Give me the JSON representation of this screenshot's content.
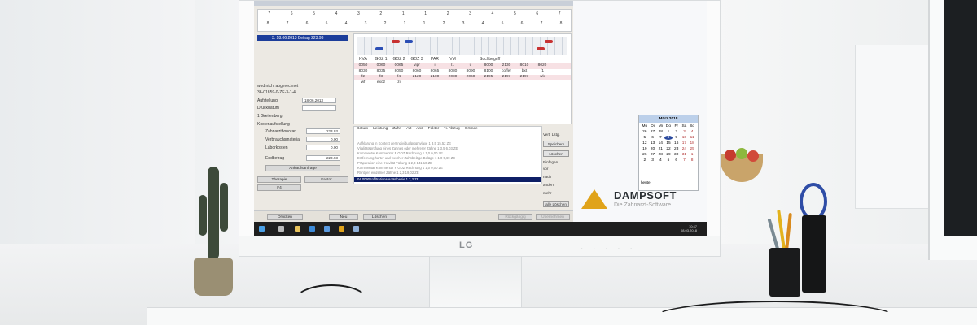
{
  "app": {
    "tooth_header": {
      "row_top": [
        "7",
        "6",
        "5",
        "4",
        "3",
        "2",
        "1",
        "1",
        "2",
        "3",
        "4",
        "5",
        "6",
        "7"
      ],
      "row_bottom": [
        "8",
        "7",
        "6",
        "5",
        "4",
        "3",
        "2",
        "1",
        "1",
        "2",
        "3",
        "4",
        "5",
        "6",
        "7",
        "8"
      ]
    },
    "left_panel": {
      "selected_item": "3. 18.06.2013 Betrag 223.93",
      "checkbox_label": "wird nicht abgerechnet",
      "reference_code": "36-01859-0-ZE-3-1-4",
      "aufstellung_label": "Aufstellung",
      "aufstellung_value": "18.06.2013",
      "druckdatum_label": "Druckdatum",
      "location": "1 Greifenberg",
      "kostenaufstellung_label": "Kostenaufstellung",
      "zahnarzthonorar_label": "Zahnarzthonorar",
      "zahnarzthonorar_value": "223.93",
      "verbrauchsmaterial_label": "Verbrauchsmaterial",
      "verbrauchsmaterial_value": "0.00",
      "laborkosten_label": "Laborkosten",
      "laborkosten_value": "0.00",
      "endbetrag_label": "Endbetrag",
      "endbetrag_value": "223.93",
      "ankaufsanfrage_button": "Ankaufsanfrage",
      "therapie_button": "Therapie",
      "faktor_button": "Faktor",
      "f4_button": "F4"
    },
    "codes_table": {
      "headers": [
        "KVA",
        "GOZ 1",
        "GOZ 2",
        "GOZ 3",
        "PAR",
        "VM",
        "",
        "Suchbegriff",
        "",
        "",
        ""
      ],
      "rows": [
        [
          "0050",
          "0060",
          "0065",
          "vipr",
          "i",
          "l1",
          "u",
          "8000",
          "2130",
          "8010",
          "8020"
        ],
        [
          "8030",
          "8035",
          "8050",
          "8060",
          "8065",
          "8080",
          "8090",
          "8100",
          "coffer",
          "bxt",
          "f1"
        ],
        [
          "f2",
          "f3",
          "f4",
          "2120",
          "2100",
          "2080",
          "2060",
          "2195",
          "2197",
          "2197",
          "wk"
        ],
        [
          "wf",
          "exc2",
          "zi",
          "",
          "",
          "",
          "",
          "",
          "",
          "",
          ""
        ]
      ]
    },
    "lower_table": {
      "headers": [
        "Datum",
        "Leistung",
        "Zahn",
        "Art",
        "Anz",
        "Faktor",
        "%-Abzug",
        "Gründe"
      ],
      "art_value": "ZE",
      "faktor_value": "2,3000",
      "abzug_value": "0",
      "rows": [
        "Aufklärung in Kontext der Individualprophylaxe 1 3,5 15,52 ZE",
        "Vitalitätsprüfung eines Zahnes oder mehrerer Zähne 1 3,5 6,03 ZE",
        "Kommentar Kommentar F GOZ Rechnung 1 1,0 0,00 ZE",
        "Entfernung harter und weicher Zahnbeläge Beläge 1 1,0 5,69 ZE",
        "Präparation einer Kavität Füllung 1 2,3 141,10 ZE",
        "Kommentar Kommentar F GOZ Rechnung 1 1,0 0,00 ZE",
        "Röntgen einzelner Zähne 1 2,3 19,02 ZE"
      ],
      "selected_row": "04 0090 Infiltrations/Anästhesie 1 2,3 ZE"
    },
    "right_controls": {
      "vert_label": "Vert. Lstg.",
      "speichern_button": "Speichern",
      "loeschen_button": "Löschen",
      "einfuegen_label": "Einfügen",
      "option_vor": "vor",
      "option_nach": "nach",
      "option_aendern": "ändern",
      "option_mehr": "mehr",
      "alle_loeschen_button": "alle Löschen"
    },
    "bottom_bar": {
      "drucken_button": "Drucken",
      "neu_button": "Neu",
      "loeschen_button": "Löschen",
      "rueckgaengig_button": "Rückgängig",
      "uebernehmen_button": "Übernehmen"
    }
  },
  "calendar": {
    "title": "März 2018",
    "weekdays": [
      "Mo",
      "Di",
      "Mi",
      "Do",
      "Fr",
      "Sa",
      "So"
    ],
    "days": [
      "26",
      "27",
      "28",
      "1",
      "2",
      "3",
      "4",
      "5",
      "6",
      "7",
      "8",
      "9",
      "10",
      "11",
      "12",
      "13",
      "14",
      "15",
      "16",
      "17",
      "18",
      "19",
      "20",
      "21",
      "22",
      "23",
      "24",
      "25",
      "26",
      "27",
      "28",
      "29",
      "30",
      "31",
      "1",
      "2",
      "3",
      "4",
      "5",
      "6",
      "7",
      "8"
    ],
    "highlighted_day": "8",
    "footer": "heute"
  },
  "branding": {
    "name": "DAMPSOFT",
    "tagline": "Die Zahnarzt-Software"
  },
  "taskbar": {
    "time": "10:47",
    "date": "08.03.2018"
  },
  "monitor": {
    "brand": "LG"
  }
}
